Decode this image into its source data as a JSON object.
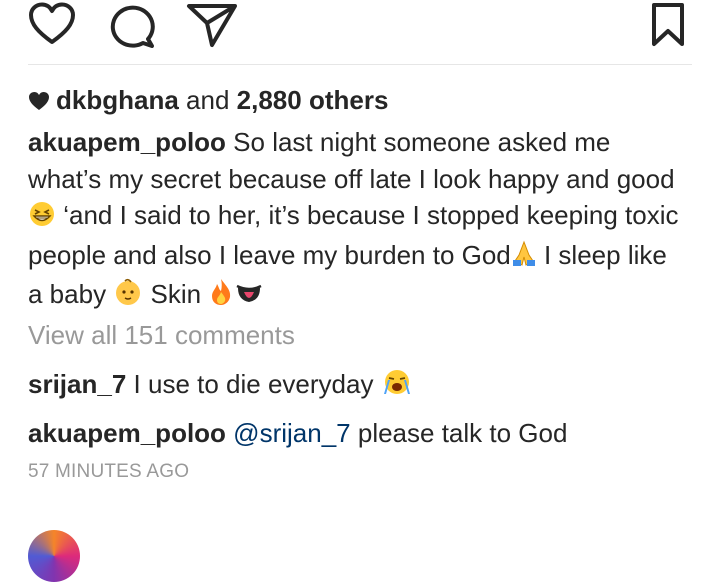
{
  "actions": {
    "like_icon": "heart-outline-icon",
    "comment_icon": "speech-bubble-icon",
    "share_icon": "paper-plane-icon",
    "save_icon": "bookmark-icon"
  },
  "likes": {
    "user": "dkbghana",
    "connector": "and",
    "count_text": "2,880 others"
  },
  "caption": {
    "username": "akuapem_poloo",
    "part1": "So last night someone asked me what’s my secret because off late I look happy and good",
    "part2": " ‘and I said to her, it’s because I stopped keeping toxic people and also I leave my burden to God",
    "part3": " I sleep like a baby ",
    "part4": "  Skin "
  },
  "view_all_comments": "View all 151 comments",
  "comments": [
    {
      "username": "srijan_7",
      "text": "I use to die everyday"
    },
    {
      "username": "akuapem_poloo",
      "mention": "@srijan_7",
      "text": "please talk to God"
    }
  ],
  "timestamp": "57 MINUTES AGO",
  "colors": {
    "text": "#262626",
    "muted": "#999999",
    "mention": "#003569",
    "divider": "#e6e6e6"
  }
}
